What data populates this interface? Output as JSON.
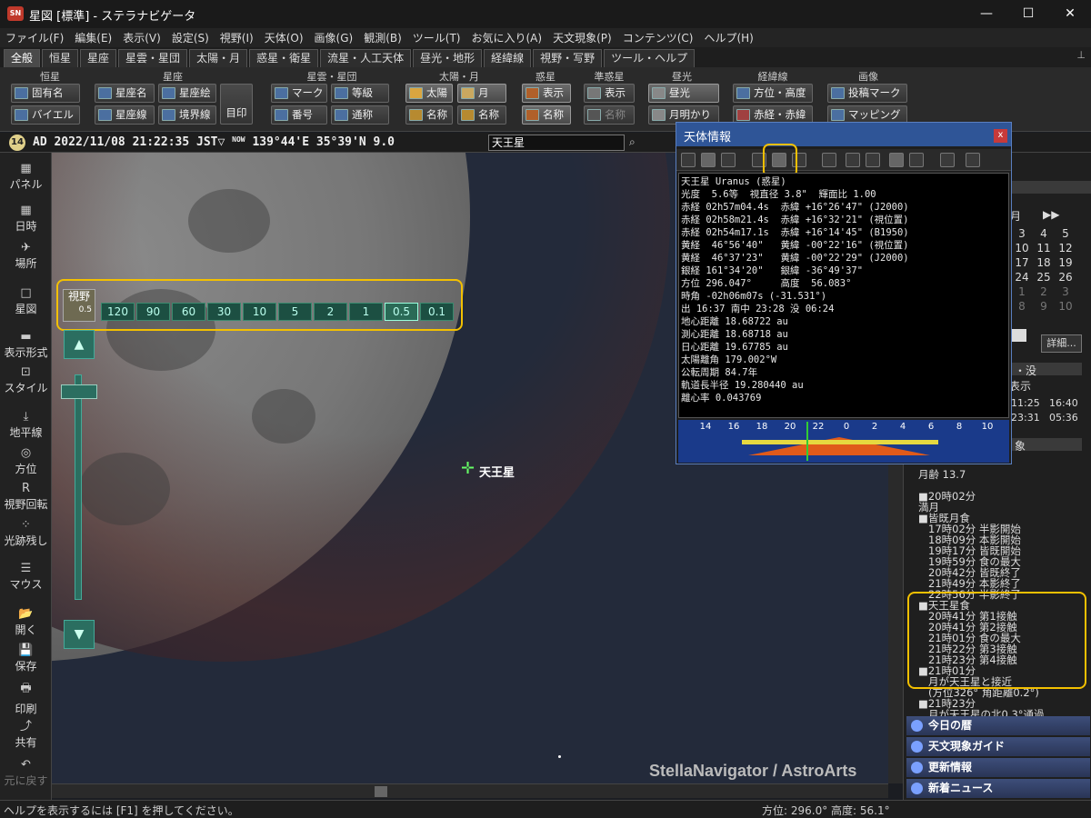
{
  "titlebar": {
    "app_icon": "SN",
    "title": "星図 [標準] - ステラナビゲータ",
    "minimize": "—",
    "maximize": "☐",
    "close": "✕"
  },
  "menus": [
    "ファイル(F)",
    "編集(E)",
    "表示(V)",
    "設定(S)",
    "視野(I)",
    "天体(O)",
    "画像(G)",
    "観測(B)",
    "ツール(T)",
    "お気に入り(A)",
    "天文現象(P)",
    "コンテンツ(C)",
    "ヘルプ(H)"
  ],
  "tabs": [
    "全般",
    "恒星",
    "星座",
    "星雲・星団",
    "太陽・月",
    "惑星・衛星",
    "流星・人工天体",
    "昼光・地形",
    "経緯線",
    "視野・写野",
    "ツール・ヘルプ"
  ],
  "ribbon": {
    "groups": [
      "恒星",
      "星座",
      "星雲・星団",
      "太陽・月",
      "惑星",
      "準惑星",
      "昼光",
      "経緯線",
      "画像"
    ],
    "buttons": {
      "proper_name": "固有名",
      "bayer": "バイエル",
      "const_name": "星座名",
      "const_line": "星座線",
      "const_art": "星座絵",
      "boundary": "境界線",
      "mark_big": "目印",
      "mark": "マーク",
      "grade": "等級",
      "number": "番号",
      "common": "通称",
      "sun": "太陽",
      "moon": "月",
      "sun_name": "名称",
      "moon_name": "名称",
      "planet_show": "表示",
      "planet_name": "名称",
      "dwarf_show": "表示",
      "dwarf_name": "名称",
      "daylight": "昼光",
      "moonlight": "月明かり",
      "azalt": "方位・高度",
      "radec": "赤経・赤緯",
      "post_mark": "投稿マーク",
      "mapping": "マッピング"
    }
  },
  "strip": {
    "moon_age": "14",
    "datetime": "AD 2022/11/08 21:22:35 JST▽",
    "now": "NOW",
    "location": "139°44'E 35°39'N",
    "magnitude": "9.0",
    "object": "天王星"
  },
  "leftbar": [
    "パネル",
    "日時",
    "場所",
    "星図",
    "表示形式",
    "スタイル",
    "地平線",
    "方位",
    "視野回転",
    "光跡残し",
    "マウス",
    "開く",
    "保存",
    "印刷",
    "共有",
    "元に戻す"
  ],
  "leftbar_icons": [
    "▦",
    "▦",
    "✈",
    "□",
    "▬",
    "⊡",
    "⤓",
    "◎",
    "R",
    "⁘",
    "☰",
    "📂",
    "💾",
    "🖶",
    "⤴",
    "↶"
  ],
  "fov": {
    "label": "視野",
    "value": "0.5",
    "buttons": [
      "120",
      "90",
      "60",
      "30",
      "10",
      "5",
      "2",
      "1",
      "0.5",
      "0.1"
    ]
  },
  "sky": {
    "object_label": "天王星",
    "watermark": "StellaNavigator / AstroArts"
  },
  "statusbar": {
    "help": "ヘルプを表示するには [F1] を押してください。",
    "azalt": "方位: 296.0° 高度: 56.1°"
  },
  "infowin": {
    "title": "天体情報",
    "close": "x",
    "body": "天王星 Uranus (惑星)\n光度  5.6等  視直径 3.8\"  輝面比 1.00\n赤経 02h57m04.4s  赤緯 +16°26'47\" (J2000)\n赤経 02h58m21.4s  赤緯 +16°32'21\" (視位置)\n赤経 02h54m17.1s  赤緯 +16°14'45\" (B1950)\n黄経  46°56'40\"   黄緯 -00°22'16\" (視位置)\n黄経  46°37'23\"   黄緯 -00°22'29\" (J2000)\n銀経 161°34'20\"   銀緯 -36°49'37\"\n方位 296.047°     高度  56.083°\n時角 -02h06m07s (-31.531°)\n出 16:37 南中 23:28 没 06:24\n地心距離 18.68722 au\n測心距離 18.68718 au\n日心距離 19.67785 au\n太陽離角 179.002°W\n公転周期 84.7年\n軌道長半径 19.280440 au\n離心率 0.043769",
    "timeline_ticks": [
      "14",
      "16",
      "18",
      "20",
      "22",
      "0",
      "2",
      "4",
      "6",
      "8",
      "10"
    ]
  },
  "calendar": {
    "month": "月",
    "nav": "▶▶",
    "rows": [
      [
        "3",
        "4",
        "5"
      ],
      [
        "10",
        "11",
        "12"
      ],
      [
        "17",
        "18",
        "19"
      ],
      [
        "24",
        "25",
        "26"
      ],
      [
        "1",
        "2",
        "3"
      ],
      [
        "8",
        "9",
        "10"
      ]
    ]
  },
  "rightpanel": {
    "detail": "詳細...",
    "rise_set_header": "・没",
    "show_label": "表示",
    "times": [
      "11:25",
      "16:40",
      "23:31",
      "05:36"
    ],
    "events_header": "象",
    "events": [
      "月齢 13.7",
      "■20時02分",
      "満月",
      "■皆既月食",
      "17時02分 半影開始",
      "18時09分 本影開始",
      "19時17分 皆既開始",
      "19時59分 食の最大",
      "20時42分 皆既終了",
      "21時49分 本影終了",
      "22時56分 半影終了",
      "■天王星食",
      "20時41分 第1接触",
      "20時41分 第2接触",
      "21時01分 食の最大",
      "21時22分 第3接触",
      "21時23分 第4接触",
      "■21時01分",
      "月が天王星と接近",
      "(方位326° 角距離0.2°)",
      "■21時23分",
      "月が天王星の北0.3°通過"
    ],
    "nav_buttons": [
      "今日の暦",
      "天文現象ガイド",
      "更新情報",
      "新着ニュース"
    ]
  }
}
